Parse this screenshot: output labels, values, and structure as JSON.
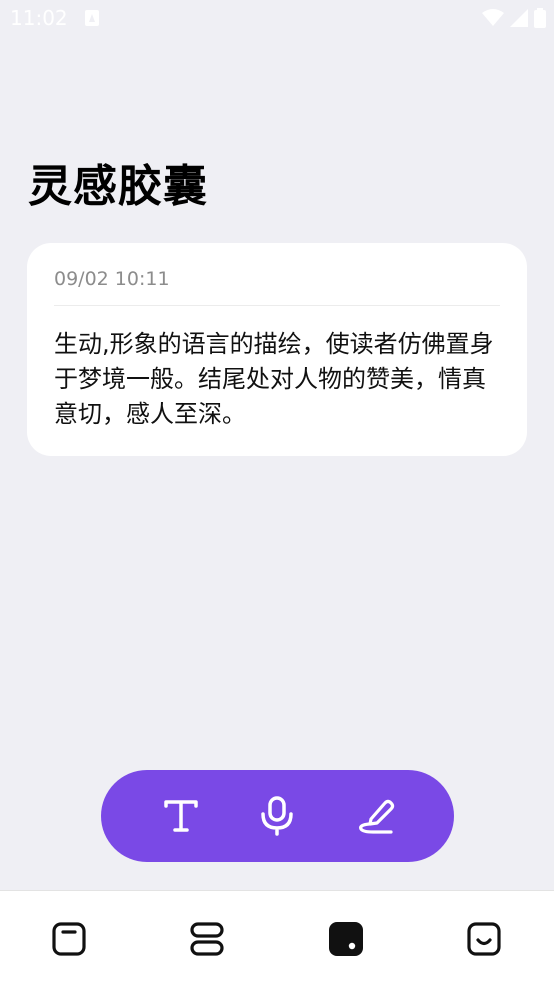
{
  "status_bar": {
    "time": "11:02"
  },
  "header": {
    "title": "灵感胶囊"
  },
  "note": {
    "date": "09/02 10:11",
    "body": "生动,形象的语言的描绘，使读者仿佛置身于梦境一般。结尾处对人物的赞美，情真意切，感人至深。"
  },
  "toolbar": {
    "color": "#7a49e6",
    "items": [
      "text-icon",
      "microphone-icon",
      "handwriting-icon"
    ]
  },
  "bottom_nav": {
    "items": [
      "note-icon",
      "list-icon",
      "capsule-icon",
      "smile-icon"
    ],
    "active_index": 2
  }
}
